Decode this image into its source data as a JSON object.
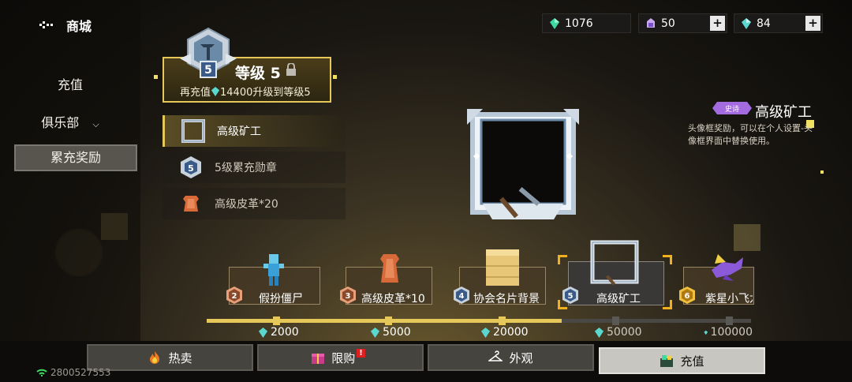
{
  "header": {
    "title": "商城",
    "back_icon": "back-arrow-icon"
  },
  "sidebar": {
    "items": [
      {
        "label": "充值"
      },
      {
        "label": "俱乐部"
      },
      {
        "label": "累充奖励"
      }
    ],
    "active_index": 2
  },
  "currency": [
    {
      "icon": "green-gem-icon",
      "value": "1076"
    },
    {
      "icon": "purple-crystal-icon",
      "value": "50"
    },
    {
      "icon": "teal-gem-icon",
      "value": "84"
    }
  ],
  "level": {
    "title": "等级 5",
    "badge_number": "5",
    "prefix": "再充值",
    "amount": "14400",
    "suffix": "升级到等级5"
  },
  "rewards": [
    {
      "label": "高级矿工"
    },
    {
      "label": "5级累充勋章"
    },
    {
      "label": "高级皮革*20"
    }
  ],
  "detail": {
    "tag": "史诗",
    "title": "高级矿工",
    "desc": "头像框奖励，可以在个人设置-头像框界面中替换使用。"
  },
  "track": {
    "items": [
      {
        "num": "2",
        "label": "假扮僵尸",
        "amount": "2000"
      },
      {
        "num": "3",
        "label": "高级皮革*10",
        "amount": "5000"
      },
      {
        "num": "4",
        "label": "协会名片背景",
        "amount": "20000"
      },
      {
        "num": "5",
        "label": "高级矿工",
        "amount": "50000"
      },
      {
        "num": "6",
        "label": "紫星小飞龙",
        "amount": "100000"
      }
    ],
    "progress_reached_index": 2
  },
  "tabs": [
    {
      "label": "热卖",
      "icon": "fire-icon"
    },
    {
      "label": "限购",
      "icon": "gift-icon",
      "badge": "!"
    },
    {
      "label": "外观",
      "icon": "hanger-icon"
    },
    {
      "label": "充值",
      "icon": "recharge-icon"
    }
  ],
  "active_tab": 3,
  "uid": "2800527553",
  "colors": {
    "gold": "#e6c85a",
    "gem": "#3fd8a0"
  }
}
